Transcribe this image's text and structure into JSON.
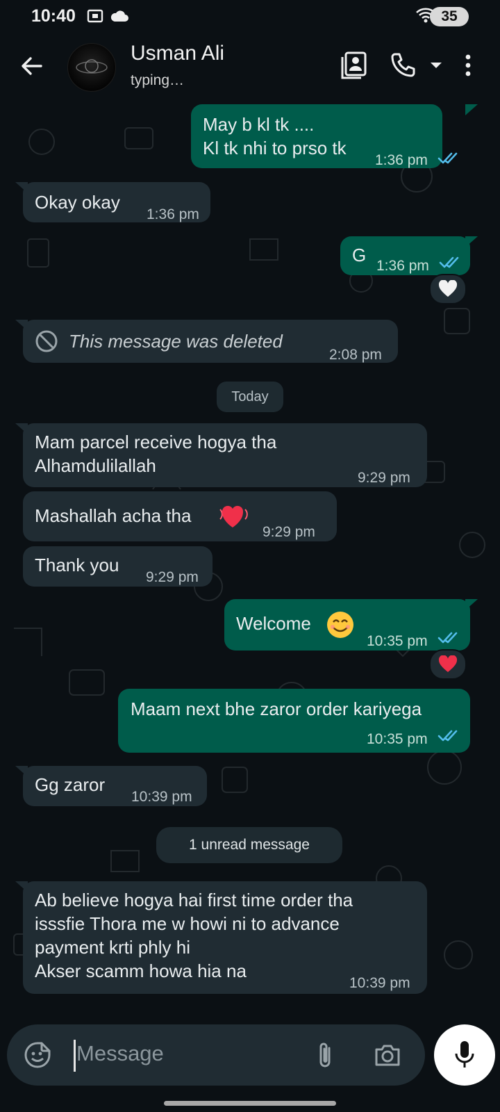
{
  "status_bar": {
    "time": "10:40",
    "battery": "35"
  },
  "header": {
    "contact_name": "Usman Ali",
    "contact_status": "typing…"
  },
  "messages": [
    {
      "direction": "out",
      "lines": [
        "May b kl tk ....",
        "Kl tk nhi to prso tk"
      ],
      "time": "1:36 pm",
      "read": true
    },
    {
      "direction": "in",
      "lines": [
        "Okay okay"
      ],
      "time": "1:36 pm"
    },
    {
      "direction": "out",
      "lines": [
        "G"
      ],
      "time": "1:36 pm",
      "read": true,
      "reaction": "white-heart"
    },
    {
      "direction": "in",
      "lines": [
        "This message was deleted"
      ],
      "time": "2:08 pm",
      "deleted": true
    },
    {
      "direction": "in",
      "lines": [
        "Mam parcel receive hogya tha",
        "Alhamdulilallah"
      ],
      "time": "9:29 pm"
    },
    {
      "direction": "in",
      "lines": [
        "Mashallah acha tha"
      ],
      "emoji": "beating-heart",
      "time": "9:29 pm"
    },
    {
      "direction": "in",
      "lines": [
        "Thank you"
      ],
      "time": "9:29 pm"
    },
    {
      "direction": "out",
      "lines": [
        "Welcome"
      ],
      "emoji": "smiling-face",
      "time": "10:35 pm",
      "read": true,
      "reaction": "red-heart"
    },
    {
      "direction": "out",
      "lines": [
        "Maam next bhe zaror order kariyega"
      ],
      "time": "10:35 pm",
      "read": true
    },
    {
      "direction": "in",
      "lines": [
        "Gg zaror"
      ],
      "time": "10:39 pm"
    },
    {
      "direction": "in",
      "lines": [
        "Ab believe hogya hai first time order tha",
        "isssfie Thora me w howi ni to advance",
        "payment krti phly hi",
        "Akser scamm howa hia na"
      ],
      "time": "10:39 pm"
    }
  ],
  "date_divider": "Today",
  "unread_divider": "1 unread message",
  "composer": {
    "placeholder": "Message"
  },
  "colors": {
    "background": "#0b1014",
    "incoming_bubble": "#202c33",
    "outgoing_bubble": "#005c4b",
    "read_ticks": "#53bdeb"
  }
}
